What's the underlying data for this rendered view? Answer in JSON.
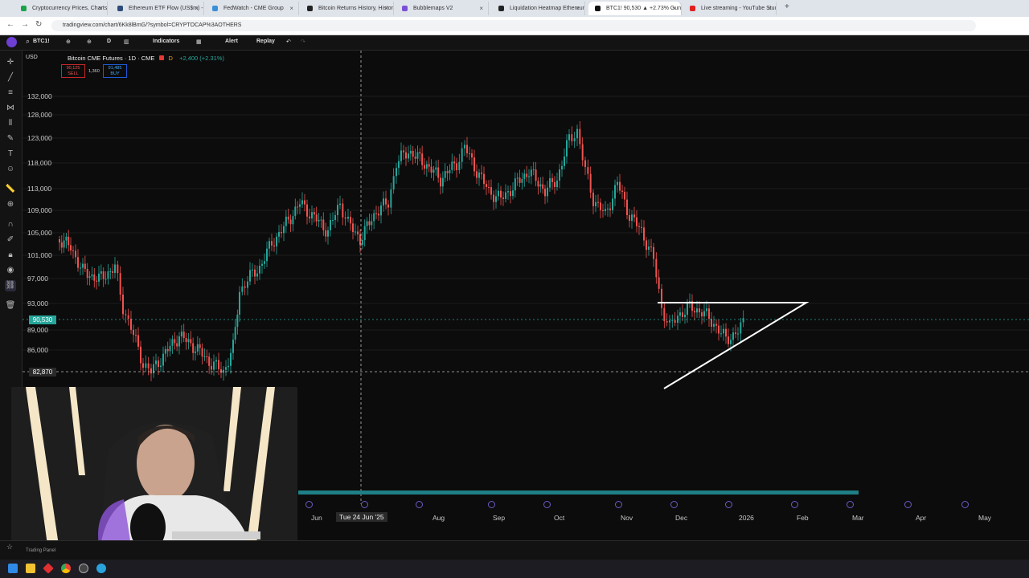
{
  "browser": {
    "tabs": [
      {
        "label": "Cryptocurrency Prices, Charts a",
        "color": "#1aa34a"
      },
      {
        "label": "Ethereum ETF Flow (US$m) - Fa",
        "color": "#2e4a7a"
      },
      {
        "label": "FedWatch - CME Group",
        "color": "#3a8fd8"
      },
      {
        "label": "Bitcoin Returns History, Historic",
        "color": "#222222"
      },
      {
        "label": "Bubblemaps V2",
        "color": "#7b4fd6"
      },
      {
        "label": "Liquidation Heatmap Ethereum",
        "color": "#222222"
      },
      {
        "label": "BTC1! 90,530 ▲ +2.73% Gunlük",
        "color": "#111111"
      },
      {
        "label": "Live streaming - YouTube Studio",
        "color": "#e02020"
      }
    ],
    "new_tab": "+",
    "url": "tradingview.com/chart/6Kk8lBmG/?symbol=CRYPTOCAP%3AOTHERS"
  },
  "toolbar": {
    "symbol": "BTC1!",
    "interval": "D",
    "indicators": "Indicators",
    "alert": "Alert",
    "replay": "Replay"
  },
  "chart": {
    "currency": "USD",
    "symbol_line": "Bitcoin CME Futures · 1D · CME",
    "change": "+2,400 (+2.31%)",
    "sell_price": "90,125",
    "sell_label": "SELL",
    "spread": "1,360",
    "buy_price": "91,485",
    "buy_label": "BUY",
    "y_ticks": [
      "132,000",
      "128,000",
      "123,000",
      "118,000",
      "113,000",
      "109,000",
      "105,000",
      "101,000",
      "97,000",
      "93,000",
      "89,000",
      "86,000"
    ],
    "current_price": "90,530",
    "crosshair_price": "82,870",
    "x_ticks": [
      "Jun",
      "Aug",
      "Sep",
      "Oct",
      "Nov",
      "Dec",
      "2026",
      "Feb",
      "Mar",
      "Apr",
      "May"
    ],
    "crosshair_date": "Tue 24 Jun '25",
    "bull_color": "#26a69a",
    "bear_color": "#ef5350"
  },
  "chart_data": {
    "type": "candlestick",
    "title": "Bitcoin CME Futures · 1D · CME",
    "ylim": [
      80000,
      135000
    ],
    "x_labels": [
      "Jun",
      "Aug",
      "Sep",
      "Oct",
      "Nov",
      "Dec",
      "2026",
      "Feb",
      "Mar",
      "Apr",
      "May"
    ],
    "annotations": [
      "triangle drawing (Dec–Jan)"
    ]
  },
  "bottom_panel": {
    "label": "Trading Panel"
  }
}
